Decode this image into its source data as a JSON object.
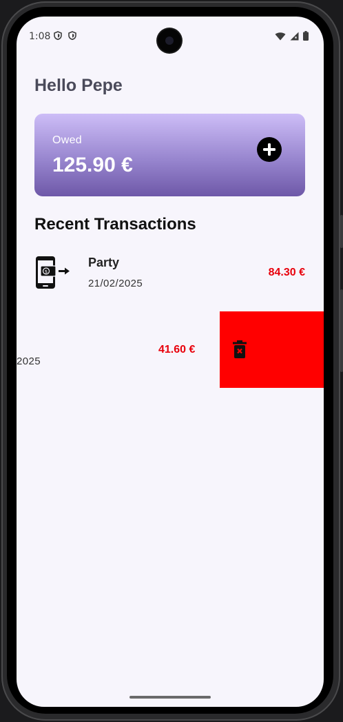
{
  "status_bar": {
    "time": "1:08",
    "left_icons": [
      "shield-icon",
      "shield-icon"
    ],
    "right_icons": [
      "wifi-icon",
      "cell-signal-icon",
      "battery-icon"
    ]
  },
  "header": {
    "greeting": "Hello Pepe"
  },
  "owed_card": {
    "label": "Owed",
    "amount": "125.90 €",
    "add_icon": "plus-circle-icon"
  },
  "transactions": {
    "title": "Recent Transactions",
    "items": [
      {
        "icon": "phone-payment-icon",
        "name": "Party",
        "date": "21/02/2025",
        "amount": "84.30 €"
      },
      {
        "icon": "phone-payment-icon",
        "name": "",
        "date": "2025",
        "amount": "41.60 €",
        "swiped": true
      }
    ]
  },
  "swipe_action": {
    "icon": "delete-icon",
    "color": "#ff0000"
  },
  "colors": {
    "accent_gradient_top": "#cdbdf7",
    "accent_gradient_bottom": "#6e58a8",
    "amount_negative": "#e8000b",
    "background": "#f7f5fc"
  }
}
